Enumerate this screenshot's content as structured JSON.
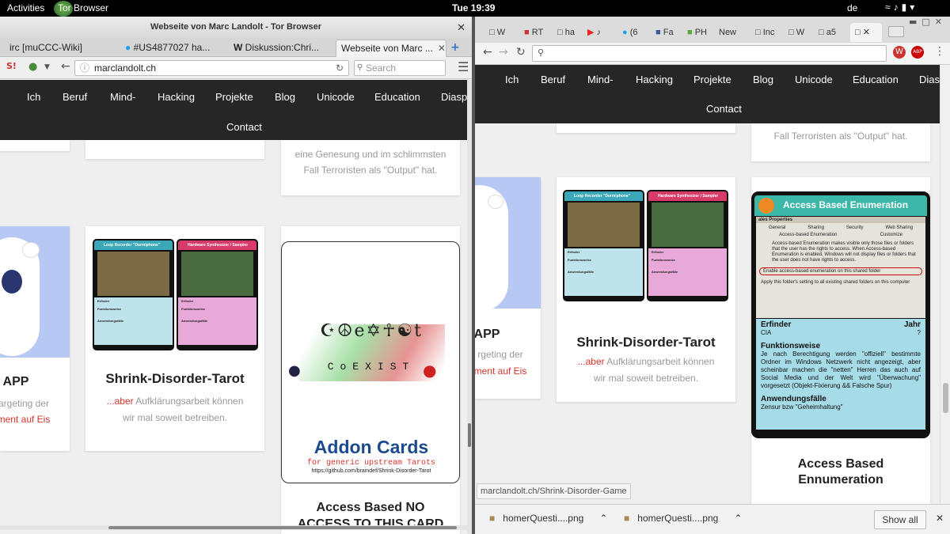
{
  "topbar": {
    "activities": "Activities",
    "app": "Tor Browser",
    "clock": "Tue 19:39",
    "keyboard": "de"
  },
  "tor": {
    "title": "Webseite von Marc Landolt - Tor Browser",
    "tabs": [
      "irc [muCCC-Wiki]",
      "#US4877027 ha...",
      "Diskussion:Chri...",
      "Webseite von Marc ..."
    ],
    "url": "marclandolt.ch",
    "search_placeholder": "Search",
    "nav": [
      "Ich",
      "Beruf",
      "Mind-",
      "Hacking",
      "Projekte",
      "Blog",
      "Unicode",
      "Education",
      "Diaspo"
    ],
    "nav2": "Contact",
    "text_genesung_1": "eine Genesung und im schlimmsten",
    "text_genesung_2": "Fall Terroristen als \"Output\" hat.",
    "app_title": "APP",
    "app_line1": "argeting der",
    "app_line2": "ment auf Eis",
    "tarot_title": "Shrink-Disorder-Tarot",
    "tarot_sub_red": "...aber",
    "tarot_sub_1": " Aufklärungsarbeit können",
    "tarot_sub_2": "wir mal soweit betreiben.",
    "addon_coexist": "CoEXIST",
    "addon_title": "Addon Cards",
    "addon_sub": "for generic upstream Tarots",
    "addon_url": "https://github.com/braindef/Shrink-Disorder-Tarot",
    "access_title_1": "Access Based NO",
    "access_title_2": "ACCESS TO THIS CARD"
  },
  "tarot_card_a": {
    "head": "Loop Recorder \"Dormiphone\"",
    "b1": "Erfinder",
    "b2": "Funktionsweise",
    "b3": "Anwendungsfälle"
  },
  "tarot_card_b": {
    "head": "Hardware Synthesizer / Sampler",
    "b1": "Erfinder",
    "b2": "Funktionsweise",
    "b3": "Anwendungsfälle"
  },
  "chrome": {
    "tabs": [
      "W",
      "RT",
      "ha",
      "",
      "(6",
      "Fa",
      "PH",
      "New",
      "Inc",
      "W",
      "a5",
      ""
    ],
    "nav": [
      "Ich",
      "Beruf",
      "Mind-",
      "Hacking",
      "Projekte",
      "Blog",
      "Unicode",
      "Education",
      "Dias"
    ],
    "nav2": "Contact",
    "text_genesung": "Fall Terroristen als \"Output\" hat.",
    "app_title": "APP",
    "app_line1": "rgeting der",
    "app_line2": "ment auf Eis",
    "tarot_title": "Shrink-Disorder-Tarot",
    "tarot_sub_red": "...aber",
    "tarot_sub_1": " Aufklärungsarbeit können",
    "tarot_sub_2": "wir mal soweit betreiben.",
    "abe": {
      "head": "Access Based Enumeration",
      "dialog_title": "ales Properties",
      "dialog_tabs": [
        "General",
        "Sharing",
        "Security",
        "Web Sharing"
      ],
      "dialog_tabs2": [
        "Access-based Enumeration",
        "Customize"
      ],
      "dialog_text": "Access-based Enumeration makes visible only those files or folders that the user has the rights to access. When Access-based Enumeration is enabled, Windows will not display files or folders that the user does not have rights to access.",
      "check1": "Enable access-based enumeration on this shared folder",
      "check2": "Apply this folder's setting to all existing shared folders on this computer",
      "erfinder": "Erfinder",
      "jahr": "Jahr",
      "erfinder_val": "CIA",
      "jahr_val": "?",
      "funktion": "Funktionsweise",
      "funktion_text": "Je nach Berechtigung werden \"offiziell\" bestimmte Ordner im Windows Netzwerk nicht angezeigt, aber scheinbar machen die \"netten\" Herren das auch auf Social Media und der Welt wird \"Überwachung\" vorgesetzt (Objekt-Fixierung && Falsche Spur)",
      "anwendung": "Anwendungsfälle",
      "anwendung_text": "Zensur bzw \"Geheimhaltung\""
    },
    "abe_title_1": "Access Based",
    "abe_title_2": "Ennumeration",
    "status_url": "marclandolt.ch/Shrink-Disorder-Game",
    "downloads": [
      "homerQuesti....png",
      "homerQuesti....png"
    ],
    "show_all": "Show all"
  }
}
